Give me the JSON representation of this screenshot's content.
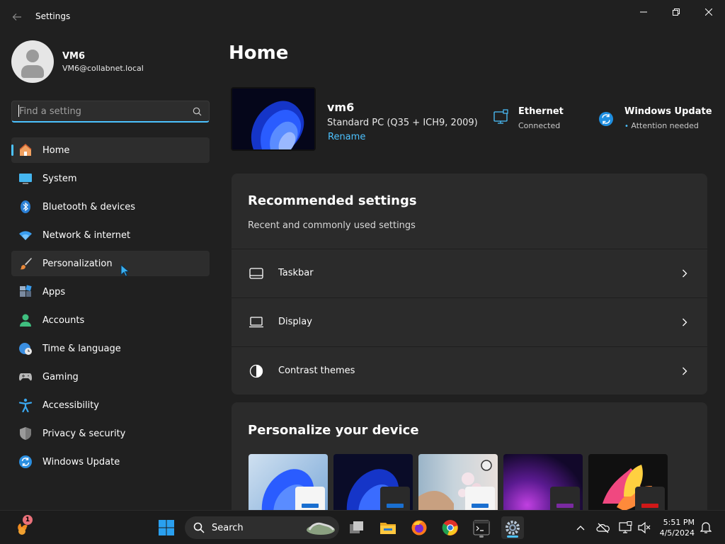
{
  "window": {
    "title": "Settings",
    "back_icon": "arrow-left-icon",
    "controls": [
      "minimize-icon",
      "maximize-icon",
      "close-icon"
    ]
  },
  "profile": {
    "name": "VM6",
    "email": "VM6@collabnet.local"
  },
  "search": {
    "placeholder": "Find a setting",
    "value": ""
  },
  "sidebar": {
    "items": [
      {
        "label": "Home",
        "icon": "home-icon",
        "active": true
      },
      {
        "label": "System",
        "icon": "monitor-icon"
      },
      {
        "label": "Bluetooth & devices",
        "icon": "bluetooth-icon"
      },
      {
        "label": "Network & internet",
        "icon": "wifi-icon"
      },
      {
        "label": "Personalization",
        "icon": "brush-icon",
        "hover": true
      },
      {
        "label": "Apps",
        "icon": "apps-icon"
      },
      {
        "label": "Accounts",
        "icon": "person-icon"
      },
      {
        "label": "Time & language",
        "icon": "globe-clock-icon"
      },
      {
        "label": "Gaming",
        "icon": "gamepad-icon"
      },
      {
        "label": "Accessibility",
        "icon": "accessibility-icon"
      },
      {
        "label": "Privacy & security",
        "icon": "shield-icon"
      },
      {
        "label": "Windows Update",
        "icon": "update-icon"
      }
    ]
  },
  "main": {
    "title": "Home",
    "device": {
      "name": "vm6",
      "model": "Standard PC (Q35 + ICH9, 2009)",
      "rename_label": "Rename"
    },
    "status": {
      "ethernet": {
        "title": "Ethernet",
        "subtitle": "Connected"
      },
      "update": {
        "title": "Windows Update",
        "subtitle": "Attention needed"
      }
    },
    "recommended": {
      "title": "Recommended settings",
      "subtitle": "Recent and commonly used settings",
      "rows": [
        {
          "label": "Taskbar",
          "icon": "taskbar-icon"
        },
        {
          "label": "Display",
          "icon": "laptop-icon"
        },
        {
          "label": "Contrast themes",
          "icon": "contrast-icon"
        }
      ]
    },
    "personalize": {
      "title": "Personalize your device",
      "themes": [
        "windows-light-theme",
        "windows-dark-theme",
        "flowers-theme",
        "glow-theme",
        "captured-motion-theme"
      ]
    }
  },
  "taskbar": {
    "search_label": "Search",
    "notification_count": "1",
    "time": "5:51 PM",
    "date": "4/5/2024"
  },
  "colors": {
    "accent": "#4cc2ff",
    "background": "#202020",
    "card": "#2b2b2b"
  }
}
